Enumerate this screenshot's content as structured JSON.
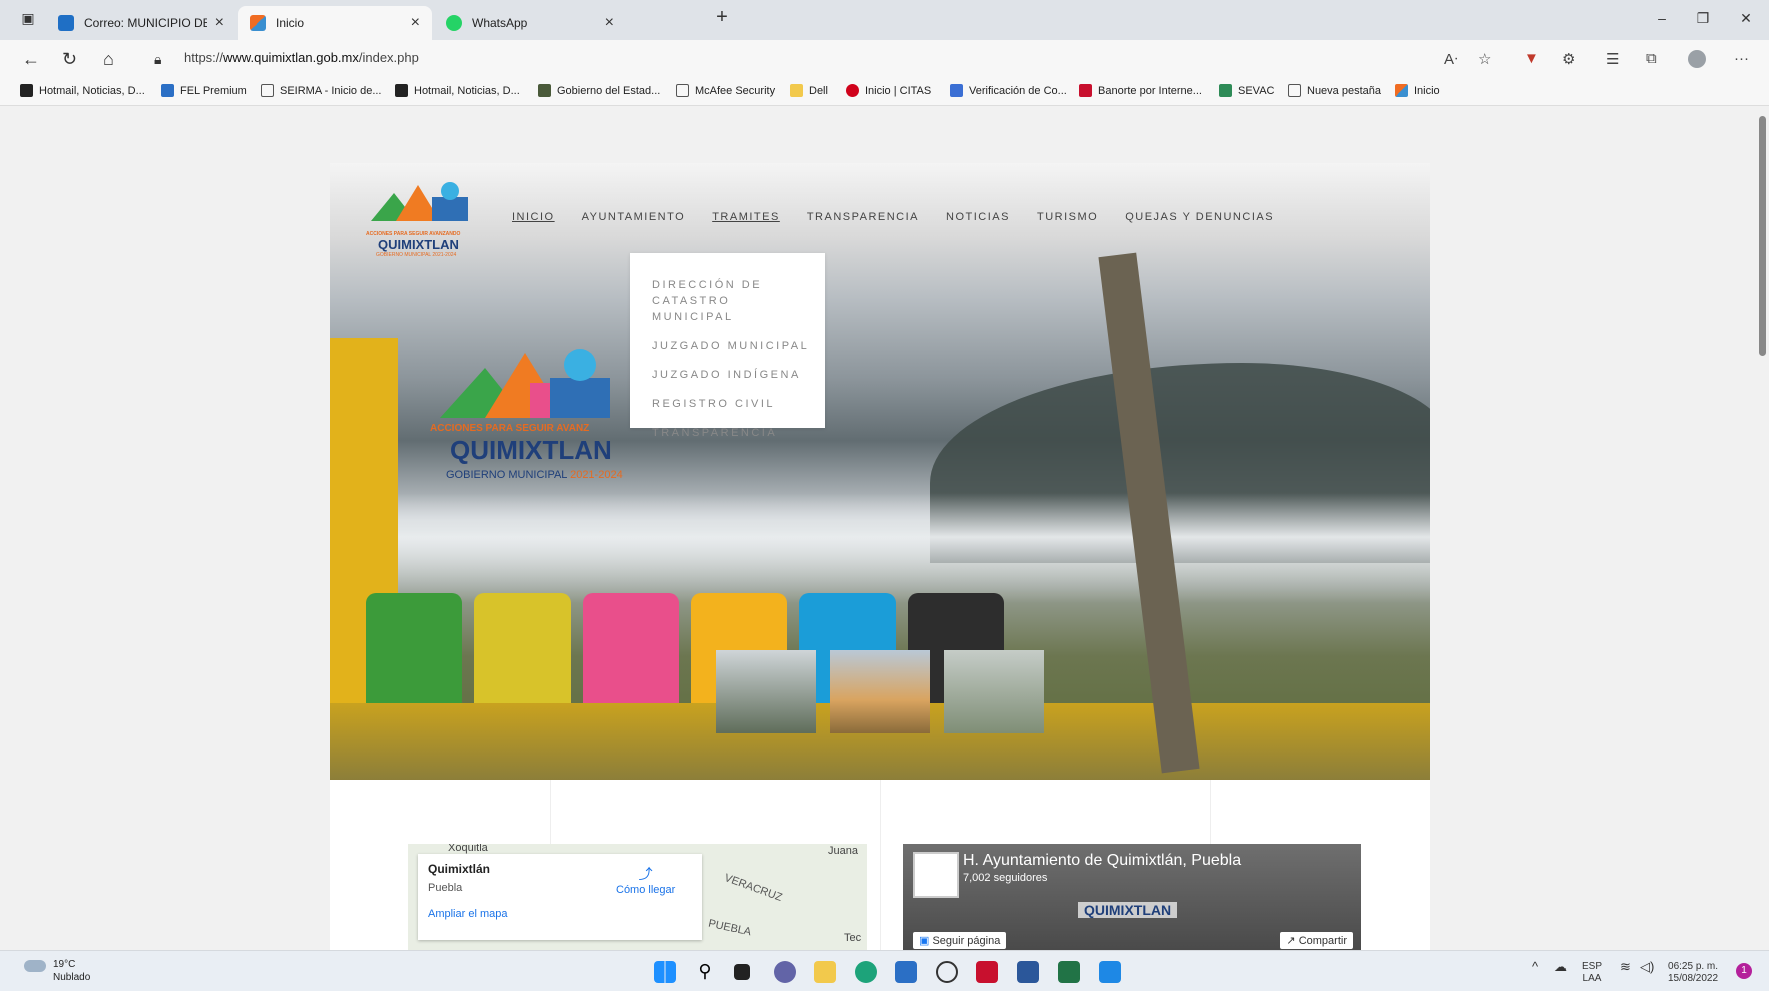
{
  "browser": {
    "tabs": [
      {
        "label": "Correo: MUNICIPIO DE QUIMIXTL",
        "icon": "outlook-icon"
      },
      {
        "label": "Inicio",
        "icon": "joomla-icon"
      },
      {
        "label": "WhatsApp",
        "icon": "whatsapp-icon"
      }
    ],
    "url_prefix": "https://",
    "url_domain": "www.quimixtlan.gob.mx",
    "url_path": "/index.php",
    "bookmarks": [
      "Hotmail, Noticias, D...",
      "FEL Premium",
      "SEIRMA - Inicio de...",
      "Hotmail, Noticias, D...",
      "Gobierno del Estad...",
      "McAfee Security",
      "Dell",
      "Inicio | CITAS",
      "Verificación de Co...",
      "Banorte por Interne...",
      "SEVAC",
      "Nueva pestaña",
      "Inicio"
    ]
  },
  "site": {
    "brand_tagline": "ACCIONES PARA SEGUIR AVANZANDO",
    "brand_name": "QUIMIXTLAN",
    "brand_sub": "GOBIERNO MUNICIPAL 2021-2024",
    "nav": [
      "INICIO",
      "AYUNTAMIENTO",
      "TRAMITES",
      "TRANSPARENCIA",
      "NOTICIAS",
      "TURISMO",
      "QUEJAS Y DENUNCIAS"
    ],
    "dropdown": [
      "DIRECCIÓN DE CATASTRO MUNICIPAL",
      "JUZGADO MUNICIPAL",
      "JUZGADO INDÍGENA",
      "REGISTRO CIVIL",
      "TRANSPARENCIA"
    ],
    "hero_tagline": "ACCIONES PARA SEGUIR AVANZ",
    "hero_name": "QUIMIXTLAN",
    "hero_sub_a": "GOBIERNO MUNICIPAL ",
    "hero_sub_b": "2021-2024"
  },
  "map": {
    "place": "Quimixtlán",
    "region": "Puebla",
    "directions": "Cómo llegar",
    "enlarge": "Ampliar el mapa",
    "labels": [
      "Xoquitla",
      "Juana",
      "VERACRUZ",
      "PUEBLA",
      "Tec"
    ]
  },
  "facebook": {
    "page_name": "H. Ayuntamiento de Quimixtlán, Puebla",
    "followers": "7,002 seguidores",
    "follow": "Seguir página",
    "share": "Compartir",
    "banner_name": "QUIMIXTLAN"
  },
  "taskbar": {
    "weather_temp": "19°C",
    "weather_desc": "Nublado",
    "lang_a": "ESP",
    "lang_b": "LAA",
    "time": "06:25 p. m.",
    "date": "15/08/2022",
    "notif": "1"
  }
}
